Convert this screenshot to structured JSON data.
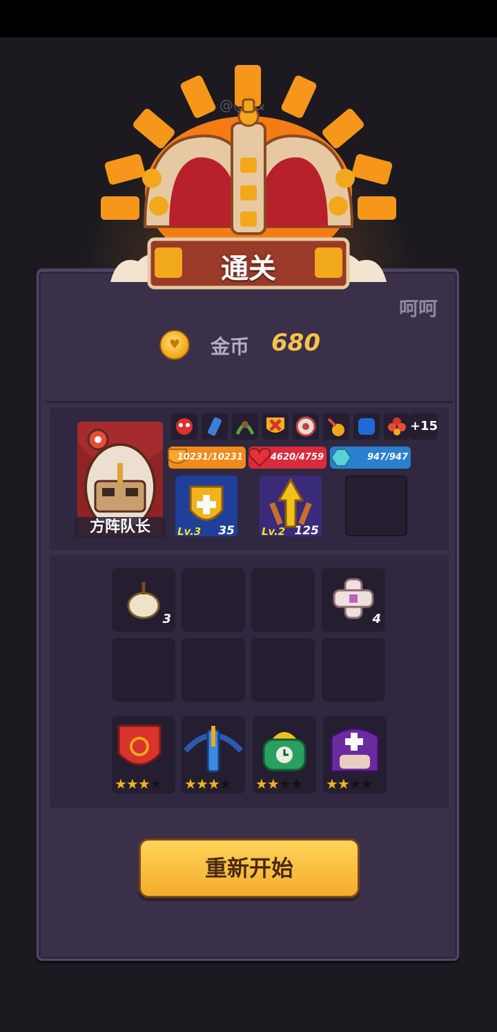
{
  "watermark": "@@*&",
  "banner": {
    "title": "通关"
  },
  "corner_text": "呵呵",
  "coins": {
    "label": "金币",
    "value": "680",
    "icon": "coin-heart-icon"
  },
  "hero": {
    "name": "方阵队长",
    "buffs": [
      "mask-buff-icon",
      "crystal-buff-icon",
      "vine-buff-icon",
      "cross-shield-buff-icon",
      "sigil-buff-icon",
      "fire-fist-buff-icon",
      "blue-gem-buff-icon",
      "flower-buff-icon"
    ],
    "more_buffs": "+15",
    "stats": {
      "shield": "10231/10231",
      "hp": "4620/4759",
      "mana": "947/947"
    },
    "skills": [
      {
        "level": "Lv.3",
        "count": "35",
        "icon": "shield-plus-icon"
      },
      {
        "level": "Lv.2",
        "count": "125",
        "icon": "arrow-up-icon"
      }
    ]
  },
  "items": [
    {
      "icon": "garlic-bomb-icon",
      "count": "3"
    },
    {
      "icon": "",
      "count": ""
    },
    {
      "icon": "",
      "count": ""
    },
    {
      "icon": "bandage-cross-icon",
      "count": "4"
    },
    {
      "icon": "",
      "count": ""
    },
    {
      "icon": "",
      "count": ""
    },
    {
      "icon": "",
      "count": ""
    },
    {
      "icon": "",
      "count": ""
    }
  ],
  "equipment": [
    {
      "icon": "red-flame-shield-icon",
      "stars": 3
    },
    {
      "icon": "blue-crossbow-icon",
      "stars": 3
    },
    {
      "icon": "green-clock-icon",
      "stars": 2
    },
    {
      "icon": "purple-priest-icon",
      "stars": 2
    }
  ],
  "restart_label": "重新开始",
  "colors": {
    "accent": "#f6c24a",
    "panel": "#3a3049",
    "button": "#f4ac2b"
  }
}
